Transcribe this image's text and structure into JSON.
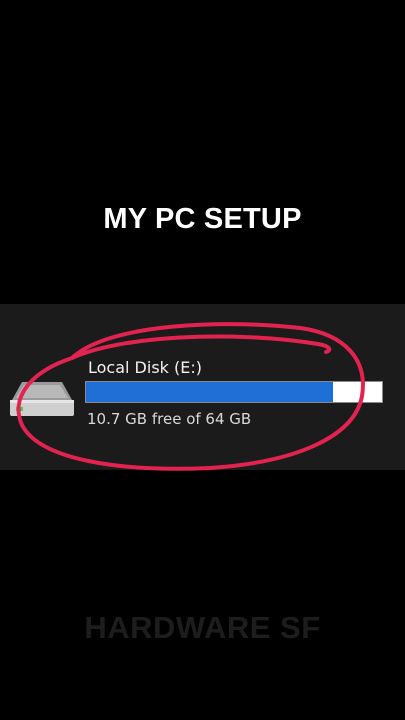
{
  "headline": "MY PC SETUP",
  "drive": {
    "name": "Local Disk (E:)",
    "free_text": "10.7 GB free of 64 GB",
    "used_fraction": 0.833,
    "icon": "hard-drive-icon",
    "bar_color": "#1f6fd6"
  },
  "annotation": {
    "color": "#e2234f"
  },
  "watermark": "HARDWARE SF"
}
